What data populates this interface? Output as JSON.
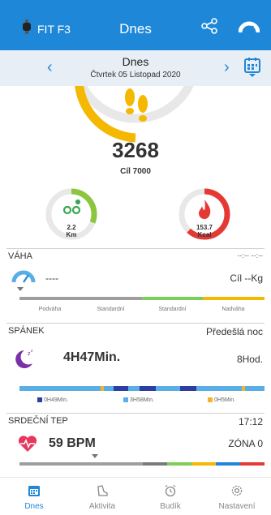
{
  "header": {
    "device": "FIT F3",
    "title": "Dnes"
  },
  "date": {
    "title": "Dnes",
    "subtitle": "Čtvrtek 05 Listopad 2020"
  },
  "steps": {
    "count": "3268",
    "goal": "Cíl 7000",
    "progress": 0.4669
  },
  "distance": {
    "value": "2.2",
    "unit": "Km",
    "progress": 0.31
  },
  "calories": {
    "value": "153.7",
    "unit": "Kcal",
    "progress": 0.62
  },
  "weight": {
    "title": "VÁHA",
    "time": "--:-- --:--",
    "value": "----",
    "goal": "Cíl --Kg",
    "scale": [
      "Podváha",
      "Standardní",
      "Standardní",
      "Nadváha"
    ]
  },
  "sleep": {
    "title": "SPÁNEK",
    "range": "Předešlá noc",
    "total": "4H47Min.",
    "goal": "8Hod.",
    "legend": [
      {
        "label": "0H49Min.",
        "color": "#2c3fa0"
      },
      {
        "label": "3H58Min.",
        "color": "#5aaee6"
      },
      {
        "label": "0H5Min.",
        "color": "#f4b429"
      }
    ]
  },
  "heart": {
    "title": "SRDEČNÍ TEP",
    "time": "17:12",
    "value": "59 BPM",
    "zone": "ZÓNA 0"
  },
  "tabs": [
    {
      "label": "Dnes",
      "icon": "calendar-icon",
      "active": true
    },
    {
      "label": "Aktivita",
      "icon": "shoe-icon",
      "active": false
    },
    {
      "label": "Budík",
      "icon": "alarm-clock-icon",
      "active": false
    },
    {
      "label": "Nastavení",
      "icon": "gear-icon",
      "active": false
    }
  ],
  "colors": {
    "primary": "#1f87d8",
    "steps": "#f5b800",
    "distance": "#8cc63f",
    "calories": "#e53935"
  }
}
